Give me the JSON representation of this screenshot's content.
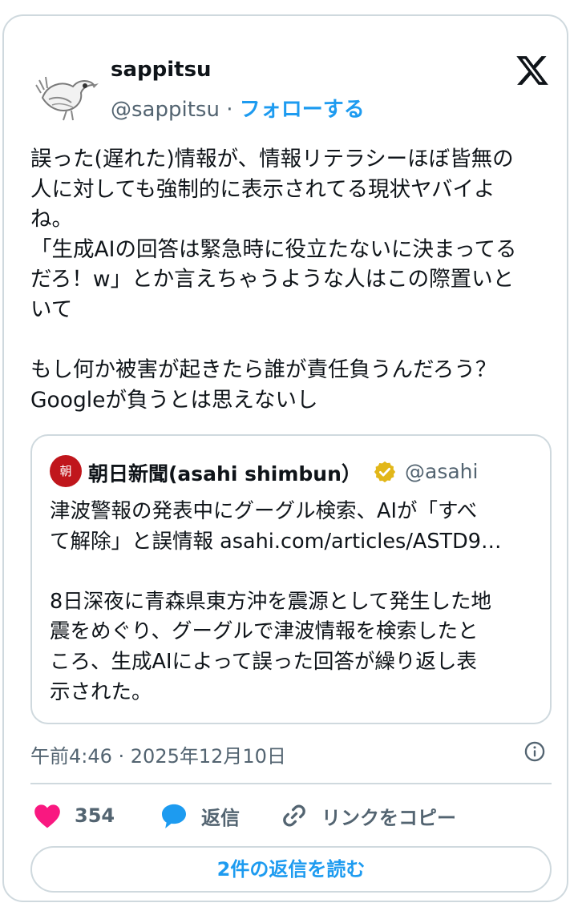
{
  "author": {
    "display_name": "sappitsu",
    "handle": "@sappitsu",
    "separator": " · ",
    "follow_label": "フォローする"
  },
  "tweet": {
    "text": "誤った(遅れた)情報が、情報リテラシーほぼ皆無の\n人に対しても強制的に表示されてる現状ヤバイよ\nね。\n「生成AIの回答は緊急時に役立たないに決まってる\nだろ！w」とか言えちゃうような人はこの際置いと\nいて\n\nもし何か被害が起きたら誰が責任負うんだろう？\nGoogleが負うとは思えないし"
  },
  "quote": {
    "logo_char": "朝",
    "name": "朝日新聞(asahi shimbun）",
    "handle": "@asahi",
    "text": "津波警報の発表中にグーグル検索、AIが「すべ\nて解除」と誤情報 asahi.com/articles/ASTD9…\n\n8日深夜に青森県東方沖を震源として発生した地\n震をめぐり、グーグルで津波情報を検索したと\nころ、生成AIによって誤った回答が繰り返し表\n示された。"
  },
  "meta": {
    "timestamp": "午前4:46 · 2025年12月10日"
  },
  "actions": {
    "like_count": "354",
    "reply_label": "返信",
    "copy_link_label": "リンクをコピー",
    "read_replies_label": "2件の返信を読む"
  },
  "icons": {
    "platform": "x-logo-icon",
    "verified": "verified-gold-badge-icon",
    "info": "info-icon",
    "like": "heart-icon",
    "reply": "speech-bubble-icon",
    "copy": "link-icon"
  },
  "colors": {
    "accent": "#1d9bf0",
    "like": "#f91880",
    "muted": "#536471",
    "border": "#cfd9de",
    "badge": "#e2b719",
    "asahi_red": "#c0161c"
  }
}
